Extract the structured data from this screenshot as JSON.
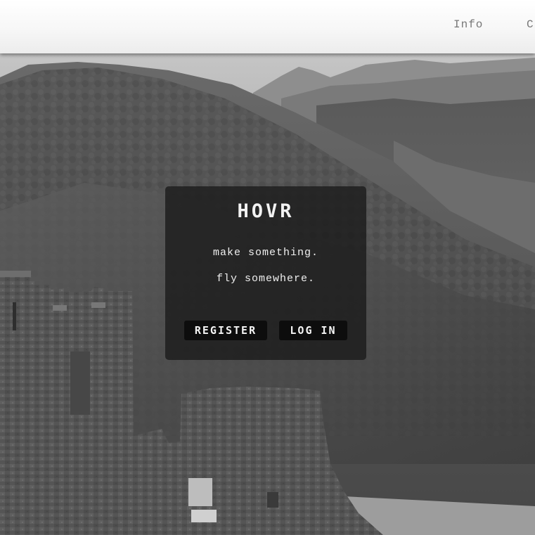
{
  "nav": {
    "items": [
      {
        "label": "Info"
      },
      {
        "label": "C"
      }
    ]
  },
  "hero": {
    "card": {
      "brand": "HOVR",
      "tagline_1": "make something.",
      "tagline_2": "fly somewhere.",
      "register_label": "REGISTER",
      "login_label": "LOG IN"
    }
  },
  "colors": {
    "nav_bg": "#f7f7f7",
    "nav_text": "#777777",
    "card_bg": "#1c1c1c",
    "button_bg": "#0d0d0d",
    "card_text": "#f2f2f2"
  }
}
